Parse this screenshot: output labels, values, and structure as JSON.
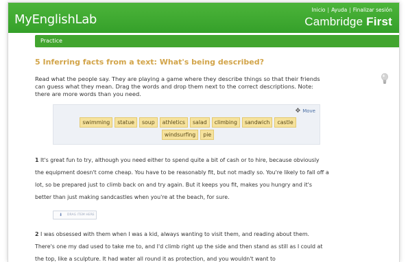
{
  "header": {
    "logo": "MyEnglishLab",
    "links": [
      "Inicio",
      "Ayuda",
      "Finalizar sesión"
    ],
    "link_separator": "|",
    "brand_prefix": "Cambridge ",
    "brand_bold": "First",
    "color": "#3aa82c"
  },
  "practice_bar": {
    "label": "Practice"
  },
  "exercise": {
    "title": "5 Inferring facts from a text: What's being described?",
    "instructions": "Read what the people say. They are playing a game where they describe things so that their friends can guess what they mean. Drag the words and drop them next to the correct descriptions. Note: there are more words than you need.",
    "hint_icon": "lightbulb-icon"
  },
  "word_bank": {
    "move_label": "Move",
    "move_icon": "move-arrows-icon",
    "words": [
      "swimming",
      "statue",
      "soup",
      "athletics",
      "salad",
      "climbing",
      "sandwich",
      "castle",
      "windsurfing",
      "pie"
    ]
  },
  "paragraphs": [
    {
      "number": "1",
      "text": "It's great fun to try, although you need either to spend quite a bit of cash or to hire, because obviously the equipment doesn't come cheap. You have to be reasonably fit, but not madly so. You're likely to fall off a lot, so be prepared just to climb back on and try again. But it keeps you fit, makes you hungry and it's better than just making sandcastles when you're at the beach, for sure."
    },
    {
      "number": "2",
      "text": "I was obsessed with them when I was a kid, always wanting to visit them, and reading about them. There's one my dad used to take me to, and I'd climb right up the side and then stand as still as I could at the top, like a sculpture. It had water all round it as protection, and you wouldn't want to"
    }
  ],
  "drop_zone": {
    "label": "DRAG ITEM HERE",
    "icon": "drag-down-arrow-icon"
  }
}
